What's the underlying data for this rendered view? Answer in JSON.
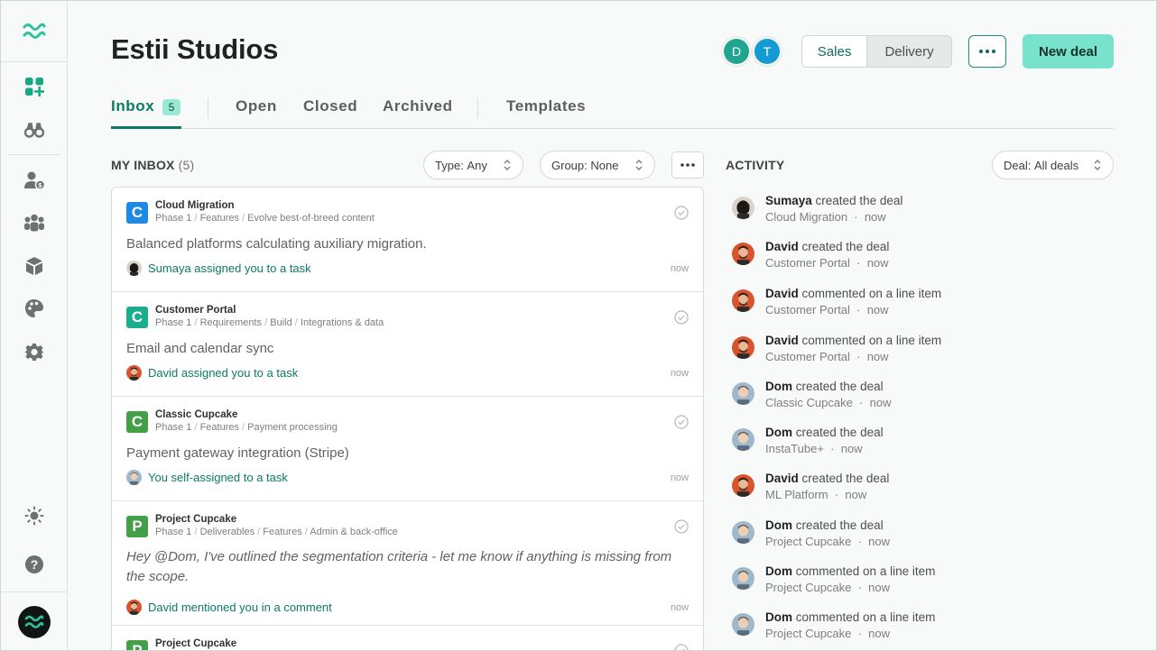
{
  "colors": {
    "accent": "#0d7a64",
    "new_deal_bg": "#79e2cc",
    "blue": "#1e88e5",
    "teal": "#1aae8f",
    "green": "#43a047"
  },
  "sidebar": {
    "items": [
      {
        "name": "dashboard-add-icon"
      },
      {
        "name": "binoculars-icon"
      },
      {
        "name": "user-dollar-icon"
      },
      {
        "name": "team-icon"
      },
      {
        "name": "box-icon"
      },
      {
        "name": "palette-icon"
      },
      {
        "name": "gear-icon"
      }
    ],
    "bottom": [
      {
        "name": "sun-icon"
      },
      {
        "name": "help-icon"
      }
    ]
  },
  "header": {
    "title": "Estii Studios",
    "avatars": [
      {
        "letter": "D",
        "color": "#21a68d"
      },
      {
        "letter": "T",
        "color": "#159bd3"
      }
    ],
    "segment": {
      "sales": "Sales",
      "delivery": "Delivery",
      "selected": "Delivery"
    },
    "new_deal": "New deal"
  },
  "tabs": {
    "inbox": "Inbox",
    "inbox_count": "5",
    "open": "Open",
    "closed": "Closed",
    "archived": "Archived",
    "templates": "Templates"
  },
  "inbox": {
    "title": "MY INBOX",
    "count": "(5)",
    "type_filter": {
      "label": "Type:",
      "value": "Any"
    },
    "group_filter": {
      "label": "Group:",
      "value": "None"
    },
    "cards": [
      {
        "icon": "C",
        "icon_color": "#1e88e5",
        "name": "Cloud Migration",
        "path": [
          "Phase 1",
          "Features",
          "Evolve best-of-breed content"
        ],
        "body": "Balanced platforms calculating auxiliary migration.",
        "actor_avatar": "sumaya",
        "footer": "Sumaya assigned you to a task",
        "time": "now"
      },
      {
        "icon": "C",
        "icon_color": "#1aae8f",
        "name": "Customer Portal",
        "path": [
          "Phase 1",
          "Requirements",
          "Build",
          "Integrations & data"
        ],
        "body": "Email and calendar sync",
        "actor_avatar": "david",
        "footer": "David assigned you to a task",
        "time": "now"
      },
      {
        "icon": "C",
        "icon_color": "#43a047",
        "name": "Classic Cupcake",
        "path": [
          "Phase 1",
          "Features",
          "Payment processing"
        ],
        "body": "Payment gateway integration (Stripe)",
        "actor_avatar": "dom",
        "footer": "You self-assigned to a task",
        "time": "now"
      },
      {
        "icon": "P",
        "icon_color": "#43a047",
        "name": "Project Cupcake",
        "path": [
          "Phase 1",
          "Deliverables",
          "Features",
          "Admin & back-office"
        ],
        "body": "Hey @Dom, I've outlined the segmentation criteria - let me know if anything is missing from the scope.",
        "actor_avatar": "david",
        "footer": "David mentioned you in a comment",
        "time": "now"
      },
      {
        "icon": "P",
        "icon_color": "#43a047",
        "name": "Project Cupcake",
        "path": [],
        "body": "",
        "actor_avatar": "",
        "footer": "",
        "time": ""
      }
    ]
  },
  "activity": {
    "title": "ACTIVITY",
    "deal_filter": {
      "label": "Deal:",
      "value": "All deals"
    },
    "items": [
      {
        "who": "Sumaya",
        "action": "created the deal",
        "deal": "Cloud Migration",
        "time": "now",
        "avatar": "sumaya"
      },
      {
        "who": "David",
        "action": "created the deal",
        "deal": "Customer Portal",
        "time": "now",
        "avatar": "david"
      },
      {
        "who": "David",
        "action": "commented on a line item",
        "deal": "Customer Portal",
        "time": "now",
        "avatar": "david"
      },
      {
        "who": "David",
        "action": "commented on a line item",
        "deal": "Customer Portal",
        "time": "now",
        "avatar": "david"
      },
      {
        "who": "Dom",
        "action": "created the deal",
        "deal": "Classic Cupcake",
        "time": "now",
        "avatar": "dom"
      },
      {
        "who": "Dom",
        "action": "created the deal",
        "deal": "InstaTube+",
        "time": "now",
        "avatar": "dom"
      },
      {
        "who": "David",
        "action": "created the deal",
        "deal": "ML Platform",
        "time": "now",
        "avatar": "david"
      },
      {
        "who": "Dom",
        "action": "created the deal",
        "deal": "Project Cupcake",
        "time": "now",
        "avatar": "dom"
      },
      {
        "who": "Dom",
        "action": "commented on a line item",
        "deal": "Project Cupcake",
        "time": "now",
        "avatar": "dom"
      },
      {
        "who": "Dom",
        "action": "commented on a line item",
        "deal": "Project Cupcake",
        "time": "now",
        "avatar": "dom"
      }
    ]
  }
}
